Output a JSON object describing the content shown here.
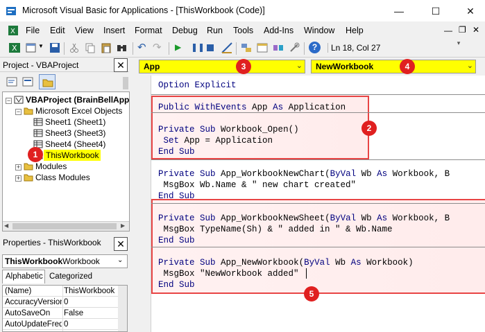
{
  "window": {
    "title": "Microsoft Visual Basic for Applications - [ThisWorkbook (Code)]",
    "controls": {
      "minimize": "—",
      "maximize": "☐",
      "close": "✕"
    }
  },
  "menubar": {
    "items": [
      "File",
      "Edit",
      "View",
      "Insert",
      "Format",
      "Debug",
      "Run",
      "Tools",
      "Add-Ins",
      "Window",
      "Help"
    ]
  },
  "toolbar": {
    "status": "Ln 18, Col 27"
  },
  "project_panel": {
    "title": "Project - VBAProject",
    "tree": {
      "root": "VBAProject (BrainBellApp",
      "folder_objects": "Microsoft Excel Objects",
      "sheets": [
        "Sheet1 (Sheet1)",
        "Sheet3 (Sheet3)",
        "Sheet4 (Sheet4)"
      ],
      "selected": "ThisWorkbook",
      "modules": "Modules",
      "class_modules": "Class Modules"
    }
  },
  "properties_panel": {
    "title": "Properties - ThisWorkbook",
    "object_name": "ThisWorkbook",
    "object_type": "Workbook",
    "tabs": [
      "Alphabetic",
      "Categorized"
    ],
    "rows": [
      {
        "name": "(Name)",
        "value": "ThisWorkbook"
      },
      {
        "name": "AccuracyVersion",
        "value": "0"
      },
      {
        "name": "AutoSaveOn",
        "value": "False"
      },
      {
        "name": "AutoUpdateFreq",
        "value": "0"
      }
    ]
  },
  "code_window": {
    "object_combo": "App",
    "procedure_combo": "NewWorkbook",
    "lines": {
      "l1": "Option Explicit",
      "l2": "Public WithEvents App As Application",
      "l3": "Private Sub Workbook_Open()",
      "l4": " Set App = Application",
      "l5": "End Sub",
      "l6": "Private Sub App_WorkbookNewChart(ByVal Wb As Workbook, B",
      "l7": " MsgBox Wb.Name & \" new chart created\"",
      "l8": "End Sub",
      "l9": "Private Sub App_WorkbookNewSheet(ByVal Wb As Workbook, B",
      "l10": " MsgBox TypeName(Sh) & \" added in \" & Wb.Name",
      "l11": "End Sub",
      "l12": "Private Sub App_NewWorkbook(ByVal Wb As Workbook)",
      "l13": " MsgBox \"NewWorkbook added\"",
      "l14": "End Sub"
    }
  },
  "annotations": {
    "b1": "1",
    "b2": "2",
    "b3": "3",
    "b4": "4",
    "b5": "5",
    "color": "#e02020"
  }
}
